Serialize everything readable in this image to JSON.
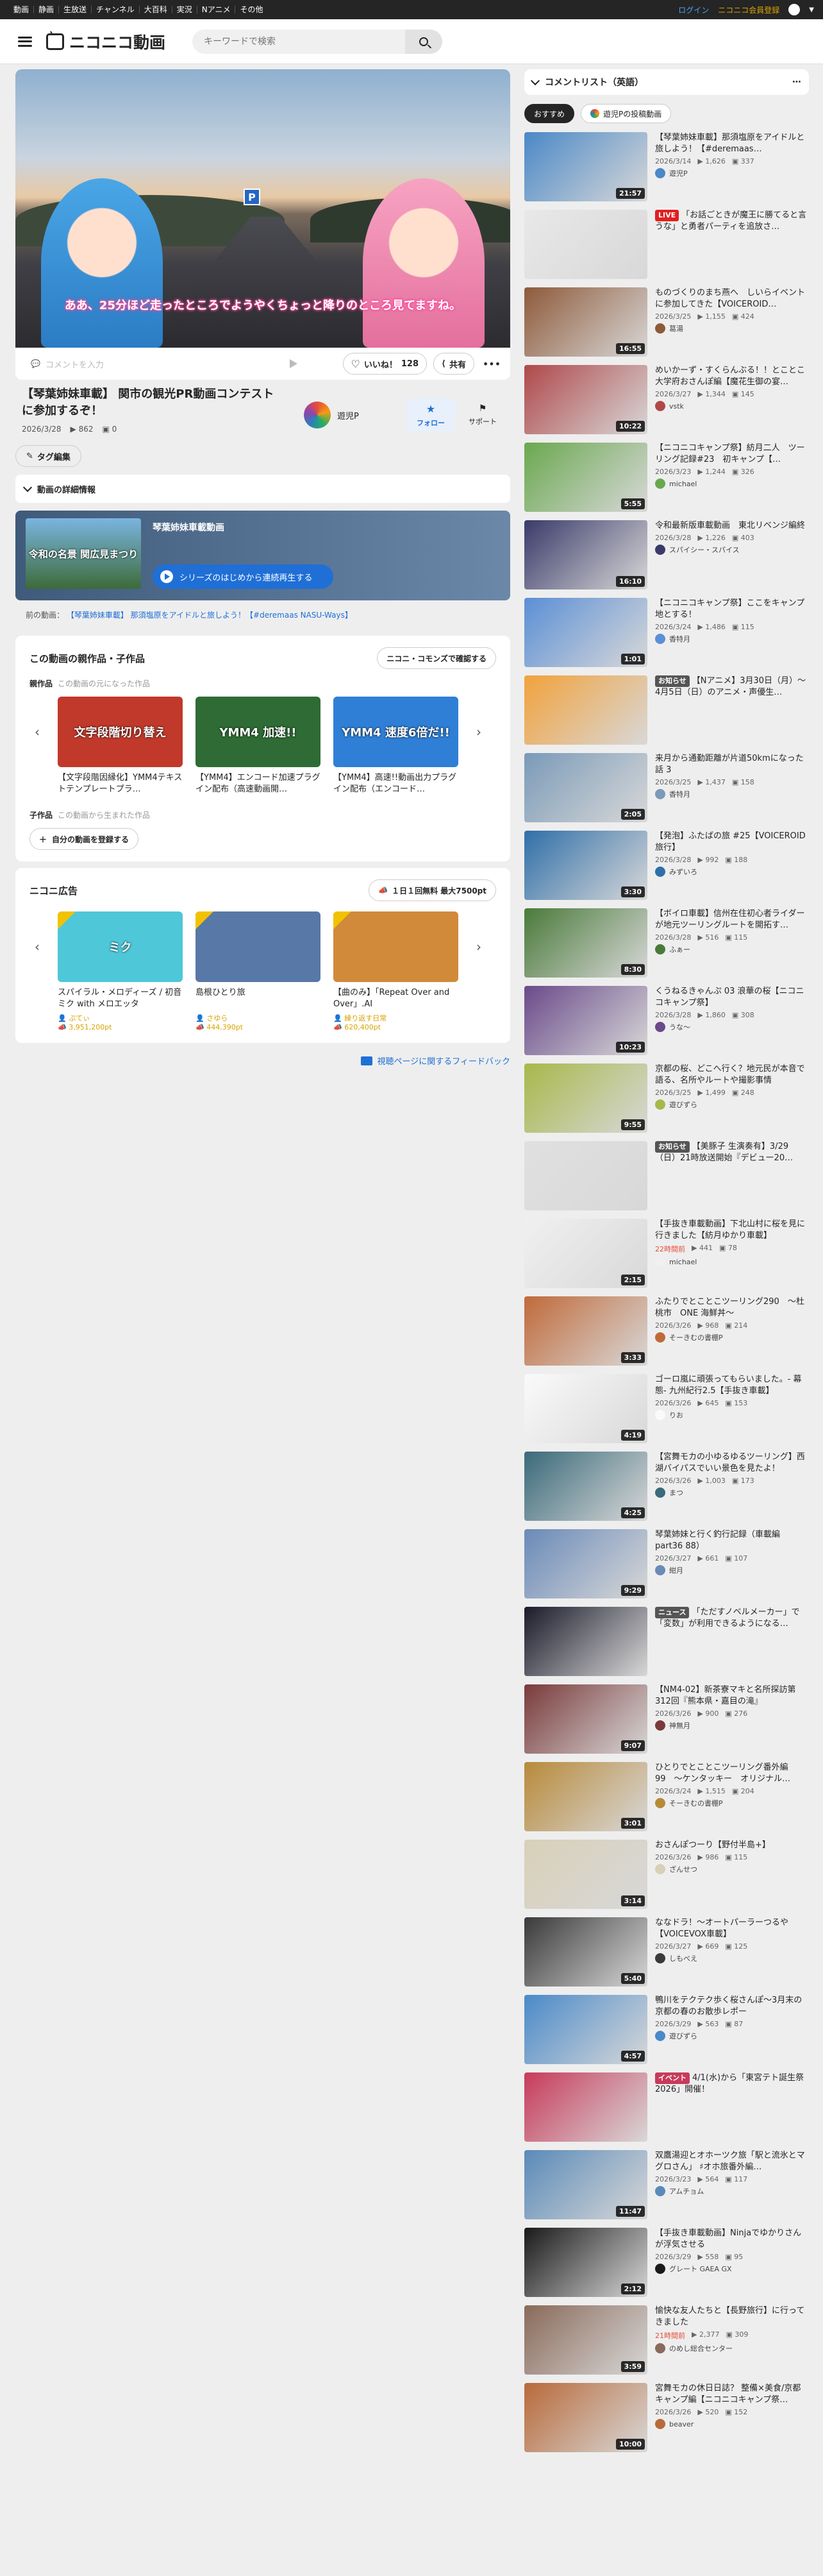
{
  "topbar": {
    "nav": [
      "動画",
      "静画",
      "生放送",
      "チャンネル",
      "大百科",
      "実況",
      "Nアニメ",
      "その他"
    ],
    "login": "ログイン",
    "premium": "ニコニコ会員登録"
  },
  "header": {
    "logo": "ニコニコ動画",
    "search_placeholder": "キーワードで検索"
  },
  "player": {
    "subtitle": "ああ、25分ほど走ったところでようやくちょっと降りのところ見てますね。",
    "sign": "P"
  },
  "actions": {
    "comment_placeholder": "コメントを入力",
    "like_label": "いいね！",
    "like_count": "128",
    "share": "共有"
  },
  "video": {
    "title": "【琴葉姉妹車載】 関市の観光PR動画コンテストに参加するぞ！",
    "date": "2026/3/28",
    "views": "862",
    "comments": "0",
    "owner": "遊児P",
    "follow": "フォロー",
    "support": "サポート"
  },
  "tag_edit": "タグ編集",
  "detail_label": "動画の詳細情報",
  "series": {
    "thumb_text": "令和の名景 関広見まつり",
    "title": "琴葉姉妹車載動画",
    "button": "シリーズのはじめから連続再生する"
  },
  "prev": {
    "label": "前の動画：",
    "link": "【琴葉姉妹車載】 那須塩原をアイドルと旅しよう！【#deremaas NASU-Ways】"
  },
  "parents": {
    "title": "この動画の親作品・子作品",
    "commons": "ニコニ・コモンズで確認する",
    "parent_label": "親作品",
    "parent_desc": "この動画の元になった作品",
    "child_label": "子作品",
    "child_desc": "この動画から生まれた作品",
    "register": "自分の動画を登録する",
    "items": [
      {
        "thumb": "文字段階切り替え",
        "title": "【文字段階因縁化】YMM4テキストテンプレートプラ…",
        "color": "#c0392b"
      },
      {
        "thumb": "YMM4 加速!!",
        "title": "【YMM4】エンコード加速プラグイン配布（高速動画開…",
        "color": "#2e6b35"
      },
      {
        "thumb": "YMM4 速度6倍だ!!",
        "title": "【YMM4】高速!!動画出力プラグイン配布（エンコード…",
        "color": "#2f7fd6"
      }
    ]
  },
  "ads": {
    "title": "ニコニ広告",
    "button": "１日１回無料 最大7500pt",
    "items": [
      {
        "thumb": "ミク",
        "title": "スパイラル・メロディーズ / 初音ミク with メロエッタ",
        "user": "ぷてぃ",
        "pts": "3,951,200pt",
        "color": "#4ec7d8"
      },
      {
        "thumb": "",
        "title": "島根ひとり旅",
        "user": "さゆら",
        "pts": "444,390pt",
        "color": "#5878a8"
      },
      {
        "thumb": "",
        "title": "【曲のみ】「Repeat Over and Over」.AI",
        "user": "繰り返す日常",
        "pts": "620,400pt",
        "color": "#d08a3a"
      }
    ]
  },
  "feedback": "視聴ページに関するフィードバック",
  "side": {
    "title": "コメントリスト（英語）",
    "tabs": [
      "おすすめ",
      "遊児Pの投稿動画"
    ],
    "items": [
      {
        "title": "【琴葉姉妹車載】那須塩原をアイドルと旅しよう！【#deremaas…",
        "date": "2026/3/14",
        "views": "1,626",
        "cm": "337",
        "user": "遊児P",
        "dur": "21:57",
        "color": "#4a88c7",
        "label": ""
      },
      {
        "title": "「お話ごときが魔王に勝てると言うな」と勇者パーティを追放さ…",
        "date": "",
        "views": "",
        "cm": "",
        "user": "",
        "dur": "",
        "color": "#e8e8e8",
        "label": "LIVE"
      },
      {
        "title": "ものづくりのまち燕へ　しいらイベントに参加してきた【VOICEROID…",
        "date": "2026/3/25",
        "views": "1,155",
        "cm": "424",
        "user": "葛湯",
        "dur": "16:55",
        "color": "#8e5a3a",
        "label": ""
      },
      {
        "title": "めいかーず・すくらんぶる！！とことこ大学府おさんぽ編【魔花生御の宴…",
        "date": "2026/3/27",
        "views": "1,344",
        "cm": "145",
        "user": "vstk",
        "dur": "10:22",
        "color": "#b0484a",
        "label": ""
      },
      {
        "title": "【ニコニコキャンプ祭】紡月二人　ツーリング記録#23　初キャンプ【…",
        "date": "2026/3/23",
        "views": "1,244",
        "cm": "326",
        "user": "michael",
        "dur": "5:55",
        "color": "#6aa84f",
        "label": ""
      },
      {
        "title": "令和最新版車載動画　東北リベンジ編終",
        "date": "2026/3/28",
        "views": "1,226",
        "cm": "403",
        "user": "スパイシー・スパイス",
        "dur": "16:10",
        "color": "#3a3a6a",
        "label": ""
      },
      {
        "title": "【ニコニコキャンプ祭】ここをキャンプ地とする！",
        "date": "2026/3/24",
        "views": "1,486",
        "cm": "115",
        "user": "香特月",
        "dur": "1:01",
        "color": "#5b8fd6",
        "label": ""
      },
      {
        "title": "【Nアニメ】3月30日（月）〜4月5日（日）のアニメ・声優生…",
        "date": "",
        "views": "",
        "cm": "",
        "user": "",
        "dur": "",
        "color": "#f2a23c",
        "label": "お知らせ"
      },
      {
        "title": "来月から通勤距離が片道50kmになった話 3",
        "date": "2026/3/25",
        "views": "1,437",
        "cm": "158",
        "user": "香特月",
        "dur": "2:05",
        "color": "#7a9ab8",
        "label": ""
      },
      {
        "title": "【発泡】ふたばの旅 #25【VOICEROID旅行】",
        "date": "2026/3/28",
        "views": "992",
        "cm": "188",
        "user": "みずいろ",
        "dur": "3:30",
        "color": "#2f6fa8",
        "label": ""
      },
      {
        "title": "【ボイロ車載】信州在住初心者ライダーが地元ツーリングルートを開拓す…",
        "date": "2026/3/28",
        "views": "516",
        "cm": "115",
        "user": "ふぁー",
        "dur": "8:30",
        "color": "#4a7a3a",
        "label": ""
      },
      {
        "title": "くうねるきゃんぷ 03 浪華の桜【ニコニコキャンプ祭】",
        "date": "2026/3/28",
        "views": "1,860",
        "cm": "308",
        "user": "うな〜",
        "dur": "10:23",
        "color": "#6a4a8a",
        "label": ""
      },
      {
        "title": "京都の桜、どこへ行く？地元民が本音で語る、名所やルートや撮影事情",
        "date": "2026/3/25",
        "views": "1,499",
        "cm": "248",
        "user": "遊びずら",
        "dur": "9:55",
        "color": "#a8b84a",
        "label": ""
      },
      {
        "title": "【美豚子 生演奏有】3/29（日）21時放送開始『デビュー20…",
        "date": "",
        "views": "",
        "cm": "",
        "user": "",
        "dur": "",
        "color": "#e0e0e0",
        "label": "お知らせ"
      },
      {
        "title": "【手抜き車載動画】下北山村に桜を見に行きました【紡月ゆかり車載】",
        "date": "22時間前",
        "views": "441",
        "cm": "78",
        "user": "michael",
        "dur": "2:15",
        "color": "#f0f0f0",
        "label": ""
      },
      {
        "title": "ふたりでとことこツーリング290　〜杜桃市　ONE 海鮮丼〜",
        "date": "2026/3/26",
        "views": "968",
        "cm": "214",
        "user": "そーきむの書棚P",
        "dur": "3:33",
        "color": "#c06a3a",
        "label": ""
      },
      {
        "title": "ゴーロ嵐に頑張ってもらいました。- 幕態- 九州紀行2.5【手抜き車載】",
        "date": "2026/3/26",
        "views": "645",
        "cm": "153",
        "user": "りお",
        "dur": "4:19",
        "color": "#fafafa",
        "label": ""
      },
      {
        "title": "【宮舞モカの小ゆるゆるツーリング】西湖バイパスでいい景色を見たよ！",
        "date": "2026/3/26",
        "views": "1,003",
        "cm": "173",
        "user": "まつ",
        "dur": "4:25",
        "color": "#3a6a7a",
        "label": ""
      },
      {
        "title": "琴葉姉妹と行く釣行記録（車載編 part36 88）",
        "date": "2026/3/27",
        "views": "661",
        "cm": "107",
        "user": "紺月",
        "dur": "9:29",
        "color": "#6a8ab8",
        "label": ""
      },
      {
        "title": "「ただすノベルメーカー」で「変数」が利用できるようになる…",
        "date": "",
        "views": "",
        "cm": "",
        "user": "",
        "dur": "",
        "color": "#1a1a2a",
        "label": "ニュース"
      },
      {
        "title": "【NM4-02】新茶寮マキと名所探訪第312回『熊本県・嘉目の滝』",
        "date": "2026/3/26",
        "views": "900",
        "cm": "276",
        "user": "神無月",
        "dur": "9:07",
        "color": "#7a3a3a",
        "label": ""
      },
      {
        "title": "ひとりでとことこツーリング番外編99　〜ケンタッキー　オリジナル…",
        "date": "2026/3/24",
        "views": "1,515",
        "cm": "204",
        "user": "そーきむの書棚P",
        "dur": "3:01",
        "color": "#b88a3a",
        "label": ""
      },
      {
        "title": "おさんぽつーり【野付半島+】",
        "date": "2026/3/26",
        "views": "986",
        "cm": "115",
        "user": "ざんせつ",
        "dur": "3:14",
        "color": "#d8d0b8",
        "label": ""
      },
      {
        "title": "ななドラ！〜オートパーラーつるや【VOICEVOX車載】",
        "date": "2026/3/27",
        "views": "669",
        "cm": "125",
        "user": "しもべえ",
        "dur": "5:40",
        "color": "#3a3a3a",
        "label": ""
      },
      {
        "title": "鴨川をテクテク歩く桜さんぽ〜3月末の京都の春のお散歩レポー",
        "date": "2026/3/29",
        "views": "563",
        "cm": "87",
        "user": "遊びずら",
        "dur": "4:57",
        "color": "#4a8ac8",
        "label": ""
      },
      {
        "title": "4/1(水)から「東宮テト誕生祭2026」開催！",
        "date": "",
        "views": "",
        "cm": "",
        "user": "",
        "dur": "",
        "color": "#c83a5a",
        "label": "イベント"
      },
      {
        "title": "双鷹湯迎とオホーツク旅「駅と流氷とマグロさん」 ♯オホ旅番外編…",
        "date": "2026/3/23",
        "views": "564",
        "cm": "117",
        "user": "アムチョム",
        "dur": "11:47",
        "color": "#5a8ab8",
        "label": ""
      },
      {
        "title": "【手抜き車載動画】Ninjaでゆかりさんが浮気させる",
        "date": "2026/3/29",
        "views": "558",
        "cm": "95",
        "user": "グレート GAEA GX",
        "dur": "2:12",
        "color": "#1a1a1a",
        "label": ""
      },
      {
        "title": "愉快な友人たちと【長野旅行】に行ってきました",
        "date": "21時間前",
        "views": "2,377",
        "cm": "309",
        "user": "のめし総合センター",
        "dur": "3:59",
        "color": "#8a6a5a",
        "label": ""
      },
      {
        "title": "宮舞モカの休日日誌？ 整備×美食/京都キャンプ編【ニコニコキャンプ祭…",
        "date": "2026/3/26",
        "views": "520",
        "cm": "152",
        "user": "beaver",
        "dur": "10:00",
        "color": "#b86a3a",
        "label": ""
      }
    ]
  }
}
